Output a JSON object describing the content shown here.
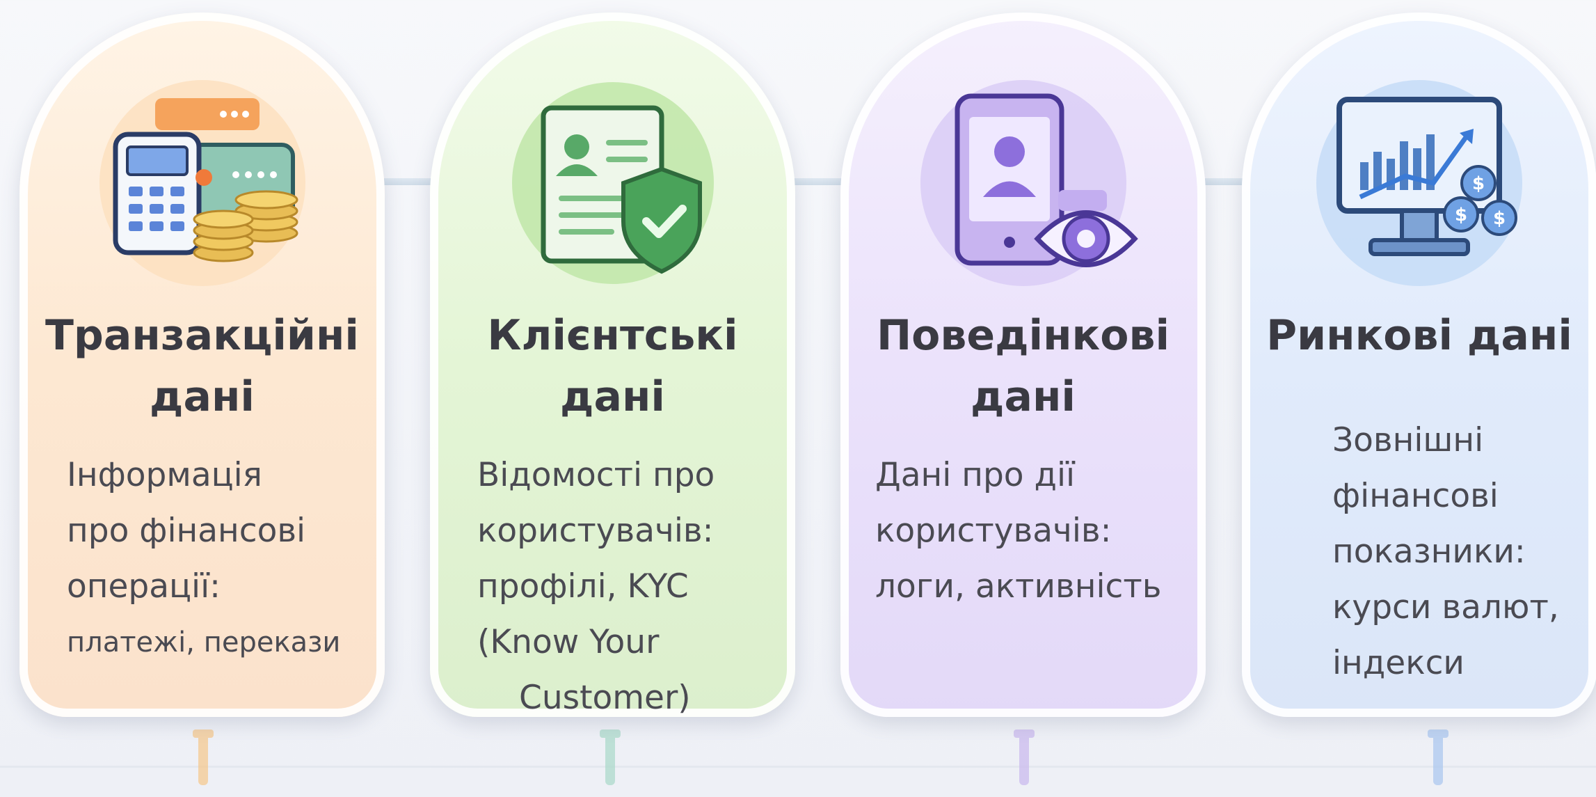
{
  "cards": [
    {
      "title": "Транзакційні\nдані",
      "description_main": "Інформація\nпро фінансові\nоперації:",
      "description_tail": "платежі, перекази",
      "icon": "calculator-coins-icon",
      "accent": "#f4a04a"
    },
    {
      "title": "Клієнтські\nдані",
      "description_main": "Відомості про\nкористувачів:\nпрофілі, KYC\n(Know Your",
      "description_tail": "Customer)",
      "icon": "id-card-shield-icon",
      "accent": "#4fae5a"
    },
    {
      "title": "Поведінкові\nдані",
      "description_main": "Дані про дії\nкористувачів:\nлоги, активність",
      "description_tail": "",
      "icon": "tablet-eye-icon",
      "accent": "#8a6be0"
    },
    {
      "title": "Ринкові дані",
      "description_main": "Зовнішні\nфінансові\nпоказники:\nкурси валют,\nіндекси",
      "description_tail": "",
      "icon": "monitor-chart-dollar-icon",
      "accent": "#4a8fe0"
    }
  ]
}
